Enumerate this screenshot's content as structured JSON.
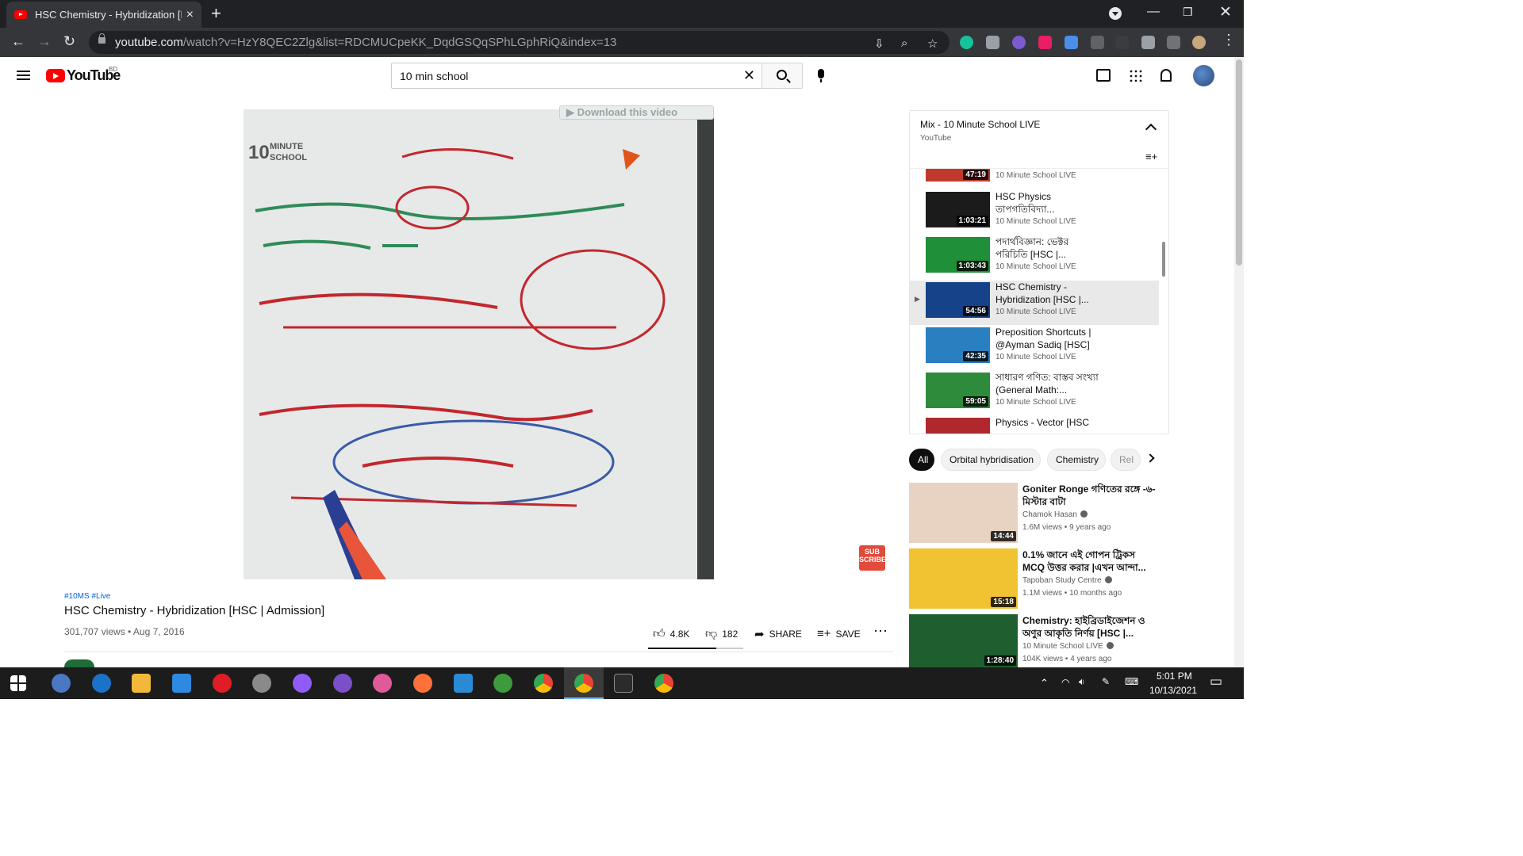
{
  "browser": {
    "tab_title": "HSC Chemistry - Hybridization [H",
    "url_domain": "youtube.com",
    "url_path": "/watch?v=HzY8QEC2Zlg&list=RDCMUCpeKK_DqdGSQqSPhLGphRiQ&index=13"
  },
  "youtube": {
    "logo_text": "YouTube",
    "country": "BD",
    "search_value": "10 min school"
  },
  "video": {
    "download_label": "▶ Download this video",
    "subscribe_badge": "SUB SCRIBE",
    "hashtags": "#10MS #Live",
    "title": "HSC Chemistry - Hybridization [HSC | Admission]",
    "meta": "301,707 views • Aug 7, 2016",
    "likes": "4.8K",
    "dislikes": "182",
    "share_label": "SHARE",
    "save_label": "SAVE",
    "like_ratio": 0.72
  },
  "playlist": {
    "title": "Mix - 10 Minute School LIVE",
    "source": "YouTube",
    "items": [
      {
        "title": "",
        "channel": "10 Minute School LIVE",
        "duration": "47:19",
        "color": "#c0392b"
      },
      {
        "title": "HSC Physics তাপগতিবিদ্যা...",
        "channel": "10 Minute School LIVE",
        "duration": "1:03:21",
        "color": "#1b1b1b"
      },
      {
        "title": "পদার্থবিজ্ঞান: ভেক্টর পরিচিতি [HSC |...",
        "channel": "10 Minute School LIVE",
        "duration": "1:03:43",
        "color": "#1f8f3a"
      },
      {
        "title": "HSC Chemistry - Hybridization [HSC |...",
        "channel": "10 Minute School LIVE",
        "duration": "54:56",
        "color": "#16428a"
      },
      {
        "title": "Preposition Shortcuts | @Ayman Sadiq [HSC]",
        "channel": "10 Minute School LIVE",
        "duration": "42:35",
        "color": "#2a7fc0"
      },
      {
        "title": "সাধারণ গণিত: বাস্তব সংখ্যা (General Math:...",
        "channel": "10 Minute School LIVE",
        "duration": "59:05",
        "color": "#2e8b3b"
      },
      {
        "title": "Physics - Vector [HSC",
        "channel": "",
        "duration": "",
        "color": "#b0282b"
      }
    ]
  },
  "chips": [
    "All",
    "Orbital hybridisation",
    "Chemistry",
    "Rel"
  ],
  "recommendations": [
    {
      "title": "Goniter Ronge গণিতের রঙ্গে -৬- মিস্টার বাটা",
      "channel": "Chamok Hasan",
      "meta": "1.6M views • 9 years ago",
      "duration": "14:44",
      "color": "#e8d3c2"
    },
    {
      "title": "0.1% জানে এই গোপন ট্রিকস MCQ উত্তর করার |এখন আন্দা...",
      "channel": "Tapoban Study Centre",
      "meta": "1.1M views • 10 months ago",
      "duration": "15:18",
      "color": "#f1c232"
    },
    {
      "title": "Chemistry: হাইব্রিডাইজেশন ও অণুর আকৃতি নির্ণয় [HSC |...",
      "channel": "10 Minute School LIVE",
      "meta": "104K views • 4 years ago",
      "duration": "1:28:40",
      "color": "#1f5e2e"
    }
  ],
  "taskbar": {
    "time": "5:01 PM",
    "date": "10/13/2021"
  }
}
